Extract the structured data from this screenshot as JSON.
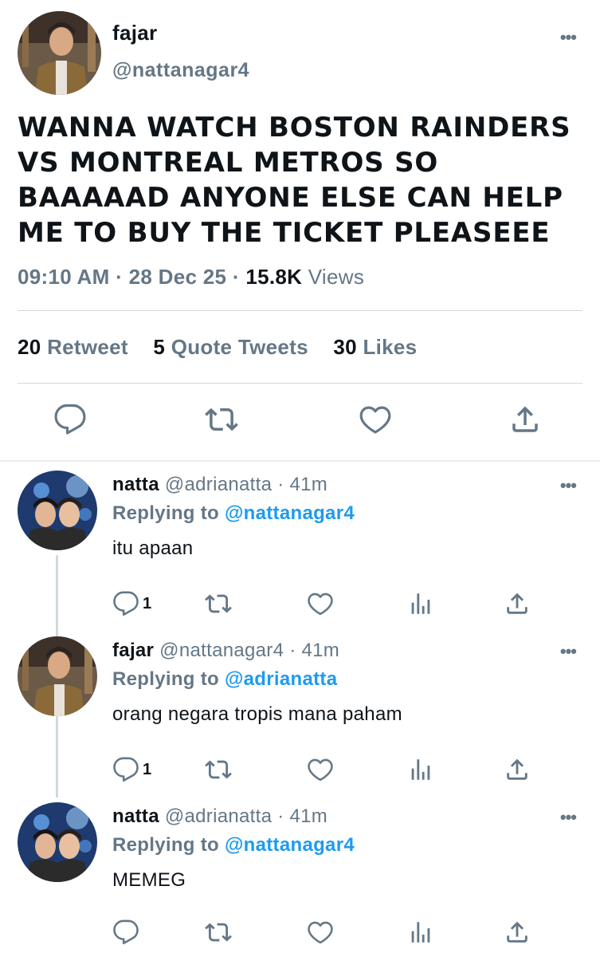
{
  "main_tweet": {
    "display_name": "fajar",
    "handle": "@nattanagar4",
    "text": "WANNA WATCH BOSTON RAINDERS VS MONTREAL METROS SO BAAAAAD ANYONE ELSE CAN HELP ME TO BUY THE TICKET PLEASEEE",
    "time": "09:10 AM",
    "date": "28 Dec 25",
    "views_count": "15.8K",
    "views_label": "Views",
    "retweet_count": "20",
    "retweet_label": "Retweet",
    "quote_count": "5",
    "quote_label": "Quote Tweets",
    "likes_count": "30",
    "likes_label": "Likes",
    "more_label": "•••",
    "icons": [
      "reply-icon",
      "retweet-icon",
      "like-icon",
      "share-icon"
    ]
  },
  "replies": [
    {
      "display_name": "natta",
      "handle": "@adrianatta",
      "time": "41m",
      "replying_prefix": "Replying to",
      "replying_to": "@nattanagar4",
      "text": "itu apaan",
      "reply_count": "1",
      "more_label": "•••"
    },
    {
      "display_name": "fajar",
      "handle": "@nattanagar4",
      "time": "41m",
      "replying_prefix": "Replying to",
      "replying_to": "@adrianatta",
      "text": "orang negara tropis mana paham",
      "reply_count": "1",
      "more_label": "•••"
    },
    {
      "display_name": "natta",
      "handle": "@adrianatta",
      "time": "41m",
      "replying_prefix": "Replying to",
      "replying_to": "@nattanagar4",
      "text": "MEMEG",
      "reply_count": "",
      "more_label": "•••"
    }
  ],
  "colors": {
    "text": "#0f1419",
    "muted": "#657786",
    "link": "#1d9bf0",
    "divider": "#cfd9de"
  }
}
